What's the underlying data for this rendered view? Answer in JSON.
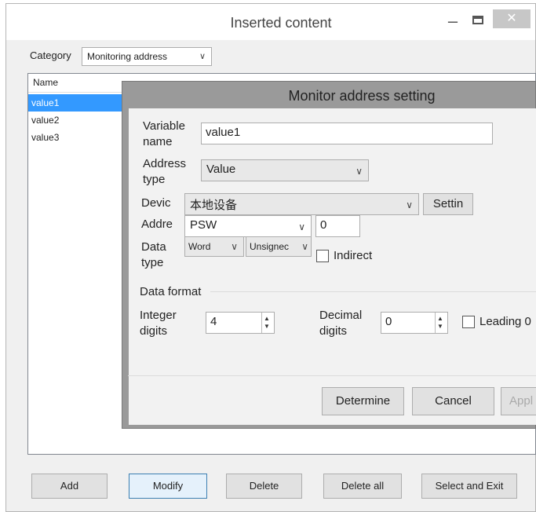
{
  "outer_window": {
    "title": "Inserted content",
    "minimize_glyph": "–",
    "close_glyph": "✕",
    "category_label": "Category",
    "category_value": "Monitoring address",
    "list_header": "Name",
    "rows": [
      "value1",
      "value2",
      "value3"
    ],
    "buttons": {
      "add": "Add",
      "modify": "Modify",
      "delete": "Delete",
      "delete_all": "Delete all",
      "select_exit": "Select and Exit"
    }
  },
  "dialog": {
    "title": "Monitor address setting",
    "variable_name_label": "Variable name",
    "variable_name_value": "value1",
    "address_type_label": "Address type",
    "address_type_value": "Value",
    "device_label": "Devic",
    "device_value": "本地设备",
    "settings_button": "Settin",
    "address_label": "Addre",
    "address_register": "PSW",
    "address_value": "0",
    "data_type_label": "Data type",
    "data_type_word": "Word",
    "data_type_sign": "Unsignec",
    "indirect_label": "Indirect",
    "data_format_label": "Data format",
    "integer_digits_label": "Integer digits",
    "integer_digits_value": "4",
    "decimal_digits_label": "Decimal digits",
    "decimal_digits_value": "0",
    "leading_label": "Leading 0",
    "determine_button": "Determine",
    "cancel_button": "Cancel",
    "apply_button": "Appl"
  }
}
